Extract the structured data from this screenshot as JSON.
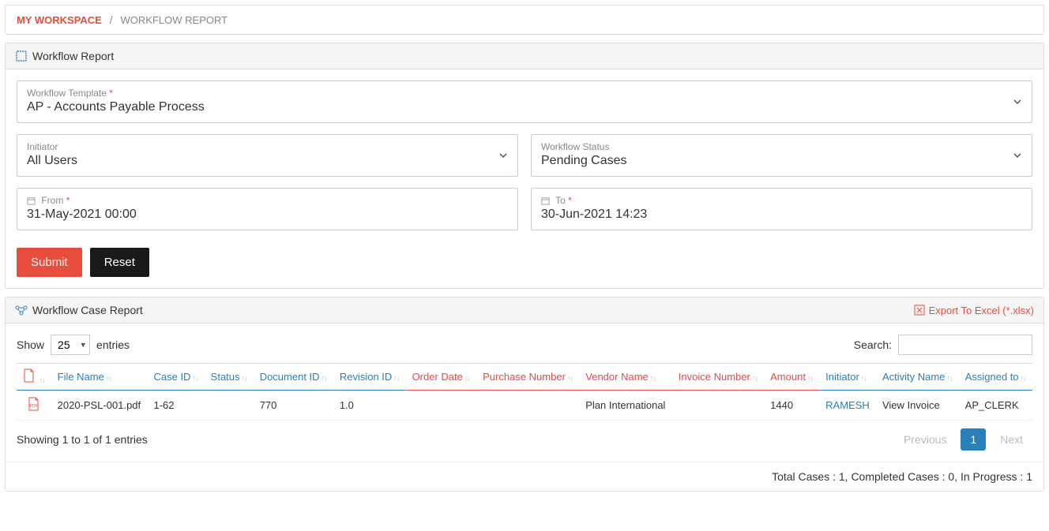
{
  "breadcrumb": {
    "home": "MY WORKSPACE",
    "sep": "/",
    "current": "WORKFLOW REPORT"
  },
  "panel1": {
    "title": "Workflow Report",
    "template": {
      "label": "Workflow Template",
      "value": "AP - Accounts Payable Process"
    },
    "initiator": {
      "label": "Initiator",
      "value": "All Users"
    },
    "status": {
      "label": "Workflow Status",
      "value": "Pending Cases"
    },
    "from": {
      "label": "From",
      "value": "31-May-2021 00:00"
    },
    "to": {
      "label": "To",
      "value": "30-Jun-2021 14:23"
    },
    "submit": "Submit",
    "reset": "Reset"
  },
  "panel2": {
    "title": "Workflow Case Report",
    "export": "Export To Excel (*.xlsx)",
    "show_label_pre": "Show",
    "show_value": "25",
    "show_label_post": "entries",
    "search_label": "Search:",
    "columns": {
      "file_name": "File Name",
      "case_id": "Case ID",
      "status": "Status",
      "document_id": "Document ID",
      "revision_id": "Revision ID",
      "order_date": "Order Date",
      "purchase_number": "Purchase Number",
      "vendor_name": "Vendor Name",
      "invoice_number": "Invoice Number",
      "amount": "Amount",
      "initiator": "Initiator",
      "activity_name": "Activity Name",
      "assigned_to": "Assigned to"
    },
    "rows": [
      {
        "file_name": "2020-PSL-001.pdf",
        "case_id": "1-62",
        "status": "",
        "document_id": "770",
        "revision_id": "1.0",
        "order_date": "",
        "purchase_number": "",
        "vendor_name": "Plan International",
        "invoice_number": "",
        "amount": "1440",
        "initiator": "RAMESH",
        "activity_name": "View Invoice",
        "assigned_to": "AP_CLERK"
      }
    ],
    "showing": "Showing 1 to 1 of 1 entries",
    "prev": "Previous",
    "page": "1",
    "next": "Next",
    "totals": "Total Cases : 1, Completed Cases : 0, In Progress : 1"
  }
}
